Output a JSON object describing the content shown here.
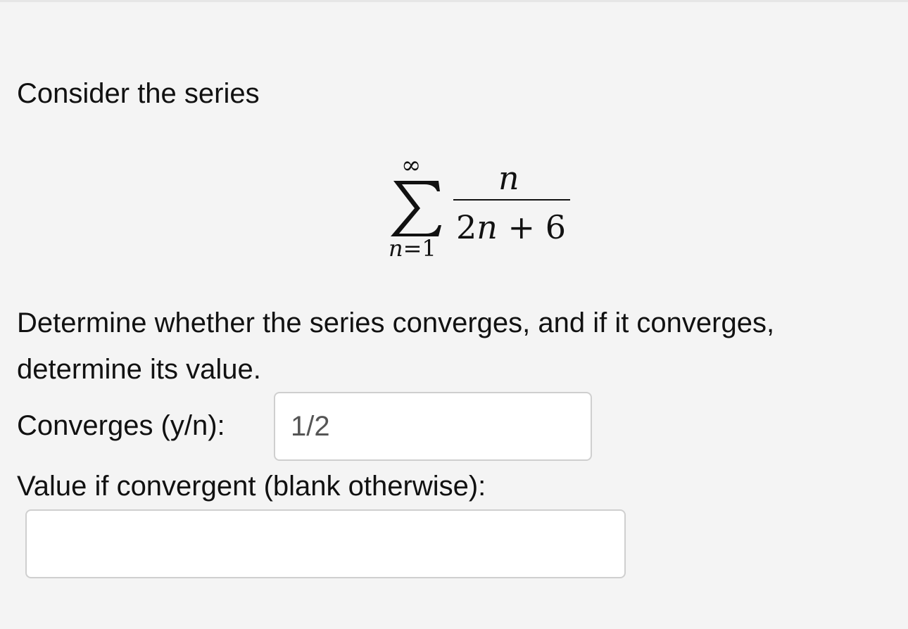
{
  "question": {
    "intro": "Consider the series",
    "prompt": "Determine whether the series converges, and if it converges, determine its value."
  },
  "series": {
    "upper_limit": "∞",
    "index_var": "n",
    "index_eq": "=",
    "index_start": "1",
    "numerator": "n",
    "denominator": {
      "coef": "2",
      "var": "n",
      "op": " + ",
      "const": "6"
    }
  },
  "converges_field": {
    "label": "Converges (y/n):",
    "value": "1/2"
  },
  "value_field": {
    "label": "Value if convergent (blank otherwise):",
    "value": ""
  }
}
